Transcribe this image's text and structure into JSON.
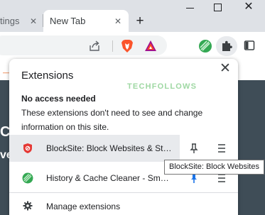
{
  "browser": {
    "tabs": [
      {
        "label": "tings",
        "state": "inactive"
      },
      {
        "label": "New Tab",
        "state": "active"
      }
    ],
    "tab_close_glyph": "✕",
    "new_tab_glyph": "+",
    "window_close_glyph": "✕",
    "toolbar_icons": [
      "share-icon",
      "brave-icon",
      "brave-rewards-icon",
      "history-cache-cleaner-icon",
      "puzzle-icon",
      "side-panel-icon"
    ]
  },
  "page": {
    "hero_line_1": "C",
    "hero_line_2": "ve"
  },
  "extensions_popup": {
    "title": "Extensions",
    "close_glyph": "✕",
    "watermark": "TECHFOLLOWS",
    "section_heading": "No access needed",
    "section_description": "These extensions don't need to see and change information on this site.",
    "items": [
      {
        "name": "BlockSite: Block Websites & Stay Focused",
        "icon": "blocksite-shield-icon",
        "pinned": false,
        "hovered": true
      },
      {
        "name": "History & Cache Cleaner - Smart Clean",
        "icon": "history-cache-cleaner-icon",
        "pinned": true,
        "hovered": false
      }
    ],
    "manage_label": "Manage extensions"
  },
  "tooltip": {
    "text": "BlockSite: Block Websites"
  },
  "colors": {
    "tabstrip": "#dee1e6",
    "popup_bg": "#ffffff",
    "hover_row": "#e8eaed",
    "pin_active": "#1a73e8",
    "blocksite_red": "#e53935",
    "cleaner_green": "#34a853"
  }
}
